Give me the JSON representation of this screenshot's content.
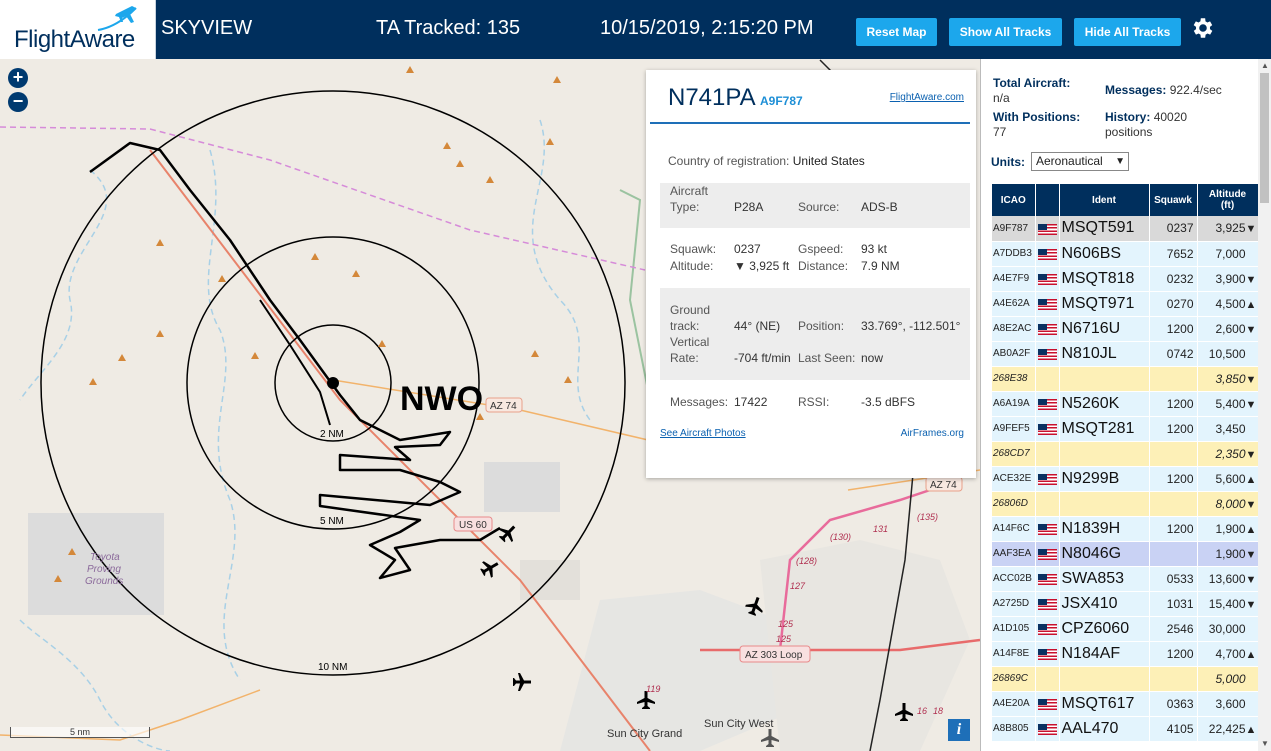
{
  "header": {
    "logo_text": "FlightAware",
    "app_title": "SKYVIEW",
    "ta_tracked": "TA Tracked: 135",
    "datetime": "10/15/2019, 2:15:20 PM",
    "reset_map": "Reset Map",
    "show_all_tracks": "Show All Tracks",
    "hide_all_tracks": "Hide All Tracks"
  },
  "map": {
    "zoom_in": "+",
    "zoom_out": "−",
    "station_label": "NWO",
    "range_labels": [
      "2 NM",
      "5 NM",
      "10 NM"
    ],
    "road_labels": [
      "AZ 74",
      "AZ 74",
      "US 60",
      "AZ 303 Loop"
    ],
    "place_labels": [
      "Toyota",
      "Proving",
      "Grounds",
      "Sun City West",
      "Sun City Grand"
    ],
    "route_numbers": [
      "131",
      "(135)",
      "(130)",
      "(128)",
      "127",
      "125",
      "125",
      "119",
      "16",
      "18"
    ],
    "scale_label": "5 nm",
    "info_label": "i"
  },
  "popup": {
    "ident": "N741PA",
    "hex": "A9F787",
    "fa_link": "FlightAware.com",
    "country_label": "Country of registration:",
    "country_value": "United States",
    "aircraft_type_label": "Aircraft Type:",
    "aircraft_type_label_1": "Aircraft",
    "aircraft_type_label_2": "Type:",
    "aircraft_type_value": "P28A",
    "source_label": "Source:",
    "source_value": "ADS-B",
    "squawk_label": "Squawk:",
    "squawk_value": "0237",
    "gspeed_label": "Gspeed:",
    "gspeed_value": "93 kt",
    "altitude_label": "Altitude:",
    "altitude_value": "▼ 3,925 ft",
    "distance_label": "Distance:",
    "distance_value": "7.9 NM",
    "ground_track_label_1": "Ground",
    "ground_track_label_2": "track:",
    "ground_track_value": "44° (NE)",
    "position_label": "Position:",
    "position_value": "33.769°, -112.501°",
    "vertical_rate_label_1": "Vertical",
    "vertical_rate_label_2": "Rate:",
    "vertical_rate_value": "-704 ft/min",
    "last_seen_label": "Last Seen:",
    "last_seen_value": "now",
    "messages_label": "Messages:",
    "messages_value": "17422",
    "rssi_label": "RSSI:",
    "rssi_value": "-3.5 dBFS",
    "photos_link": "See Aircraft Photos",
    "airframes_link": "AirFrames.org"
  },
  "sidebar": {
    "total_aircraft_label": "Total Aircraft:",
    "total_aircraft_value": "n/a",
    "messages_label": "Messages:",
    "messages_value": "922.4/sec",
    "with_positions_label": "With Positions:",
    "with_positions_value": "77",
    "history_label": "History:",
    "history_value": "40020",
    "history_unit": "positions",
    "units_label": "Units:",
    "units_value": "Aeronautical"
  },
  "table": {
    "headers": [
      "ICAO",
      "",
      "Ident",
      "Squawk",
      "Altitude (ft)"
    ],
    "header_altitude_1": "Altitude",
    "header_altitude_2": "(ft)",
    "rows": [
      {
        "icao": "A9F787",
        "ident": "MSQT591",
        "squawk": "0237",
        "alt": "3,925",
        "trend": "▼",
        "flag": true,
        "style": "sel"
      },
      {
        "icao": "A7DDB3",
        "ident": "N606BS",
        "squawk": "7652",
        "alt": "7,000",
        "trend": "",
        "flag": true,
        "style": "r"
      },
      {
        "icao": "A4E7F9",
        "ident": "MSQT818",
        "squawk": "0232",
        "alt": "3,900",
        "trend": "▼",
        "flag": true,
        "style": "r"
      },
      {
        "icao": "A4E62A",
        "ident": "MSQT971",
        "squawk": "0270",
        "alt": "4,500",
        "trend": "▲",
        "flag": true,
        "style": "r"
      },
      {
        "icao": "A8E2AC",
        "ident": "N6716U",
        "squawk": "1200",
        "alt": "2,600",
        "trend": "▼",
        "flag": true,
        "style": "r"
      },
      {
        "icao": "AB0A2F",
        "ident": "N810JL",
        "squawk": "0742",
        "alt": "10,500",
        "trend": "",
        "flag": true,
        "style": "r"
      },
      {
        "icao": "268E38",
        "ident": "",
        "squawk": "",
        "alt": "3,850",
        "trend": "▼",
        "flag": false,
        "style": "y"
      },
      {
        "icao": "A6A19A",
        "ident": "N5260K",
        "squawk": "1200",
        "alt": "5,400",
        "trend": "▼",
        "flag": true,
        "style": "r"
      },
      {
        "icao": "A9FEF5",
        "ident": "MSQT281",
        "squawk": "1200",
        "alt": "3,450",
        "trend": "",
        "flag": true,
        "style": "r"
      },
      {
        "icao": "268CD7",
        "ident": "",
        "squawk": "",
        "alt": "2,350",
        "trend": "▼",
        "flag": false,
        "style": "y"
      },
      {
        "icao": "ACE32E",
        "ident": "N9299B",
        "squawk": "1200",
        "alt": "5,600",
        "trend": "▲",
        "flag": true,
        "style": "r"
      },
      {
        "icao": "26806D",
        "ident": "",
        "squawk": "",
        "alt": "8,000",
        "trend": "▼",
        "flag": false,
        "style": "y"
      },
      {
        "icao": "A14F6C",
        "ident": "N1839H",
        "squawk": "1200",
        "alt": "1,900",
        "trend": "▲",
        "flag": true,
        "style": "r"
      },
      {
        "icao": "AAF3EA",
        "ident": "N8046G",
        "squawk": "",
        "alt": "1,900",
        "trend": "▼",
        "flag": true,
        "style": "hl"
      },
      {
        "icao": "ACC02B",
        "ident": "SWA853",
        "squawk": "0533",
        "alt": "13,600",
        "trend": "▼",
        "flag": true,
        "style": "r"
      },
      {
        "icao": "A2725D",
        "ident": "JSX410",
        "squawk": "1031",
        "alt": "15,400",
        "trend": "▼",
        "flag": true,
        "style": "r"
      },
      {
        "icao": "A1D105",
        "ident": "CPZ6060",
        "squawk": "2546",
        "alt": "30,000",
        "trend": "",
        "flag": true,
        "style": "r"
      },
      {
        "icao": "A14F8E",
        "ident": "N184AF",
        "squawk": "1200",
        "alt": "4,700",
        "trend": "▲",
        "flag": true,
        "style": "r"
      },
      {
        "icao": "26869C",
        "ident": "",
        "squawk": "",
        "alt": "5,000",
        "trend": "",
        "flag": false,
        "style": "y"
      },
      {
        "icao": "A4E20A",
        "ident": "MSQT617",
        "squawk": "0363",
        "alt": "3,600",
        "trend": "",
        "flag": true,
        "style": "r"
      },
      {
        "icao": "A8B805",
        "ident": "AAL470",
        "squawk": "4105",
        "alt": "22,425",
        "trend": "▲",
        "flag": true,
        "style": "r"
      }
    ]
  },
  "colors": {
    "header_bg": "#002f5d",
    "button_bg": "#1ca7ec",
    "row_blue": "#e3f4fd",
    "row_yellow": "#fdf0b7",
    "row_selected": "#d9d9d9",
    "row_highlight": "#c9d2f4",
    "map_bg": "#efebe4"
  }
}
